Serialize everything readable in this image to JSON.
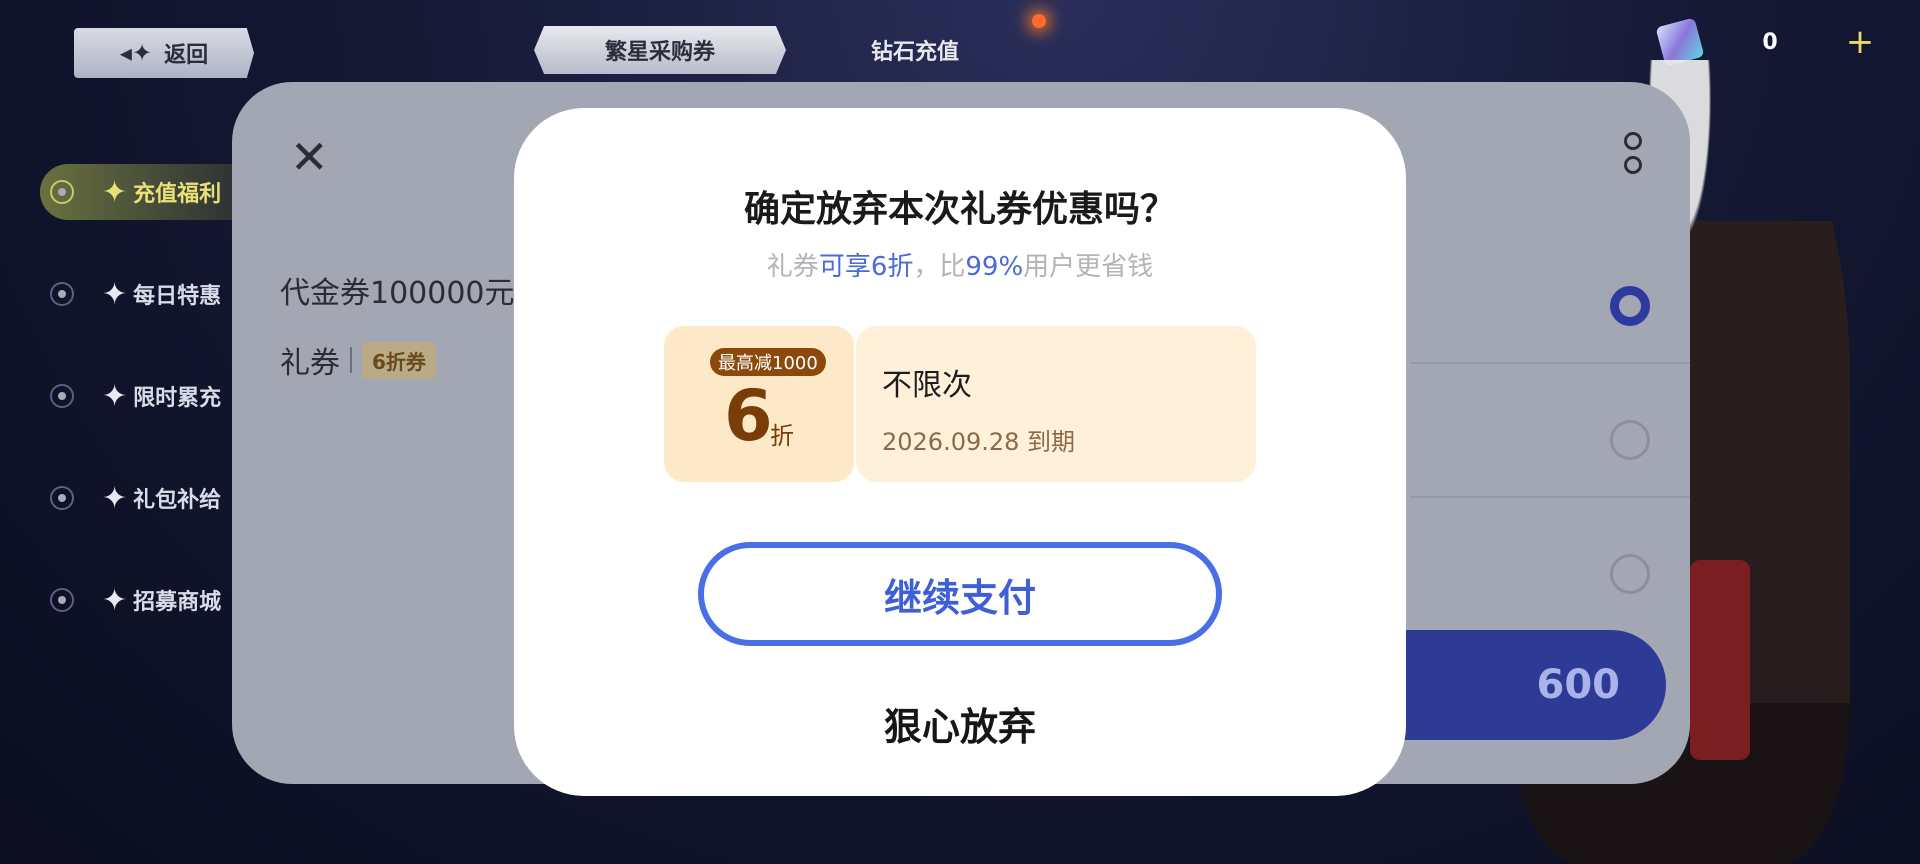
{
  "header": {
    "back_label": "返回",
    "tabs": [
      {
        "label": "繁星采购券",
        "active": true
      },
      {
        "label": "钻石充值",
        "active": false
      }
    ],
    "currency_value": "0",
    "currency_add": "+"
  },
  "sidebar": {
    "items": [
      {
        "label": "充值福利",
        "active": true
      },
      {
        "label": "每日特惠",
        "active": false
      },
      {
        "label": "限时累充",
        "active": false
      },
      {
        "label": "礼包补给",
        "active": false
      },
      {
        "label": "招募商城",
        "active": false
      }
    ]
  },
  "sheet": {
    "product_name": "代金券100000元",
    "coupon_label": "礼券",
    "coupon_tag": "6折券",
    "pay_amount": "600"
  },
  "modal": {
    "title": "确定放弃本次礼券优惠吗？",
    "subtitle": {
      "p1": "礼券",
      "h1": "可享6折",
      "p2": "，比",
      "h2": "99%",
      "p3": "用户更省钱"
    },
    "coupon": {
      "badge": "最高减1000",
      "discount": "6",
      "unit": "折",
      "limit": "不限次",
      "expire": "2026.09.28 到期"
    },
    "continue_label": "继续支付",
    "abandon_label": "狠心放弃"
  },
  "colors": {
    "accent_blue": "#4a6ee6",
    "coupon_brown": "#7a3d07",
    "coupon_bg": "#fde9c8"
  }
}
